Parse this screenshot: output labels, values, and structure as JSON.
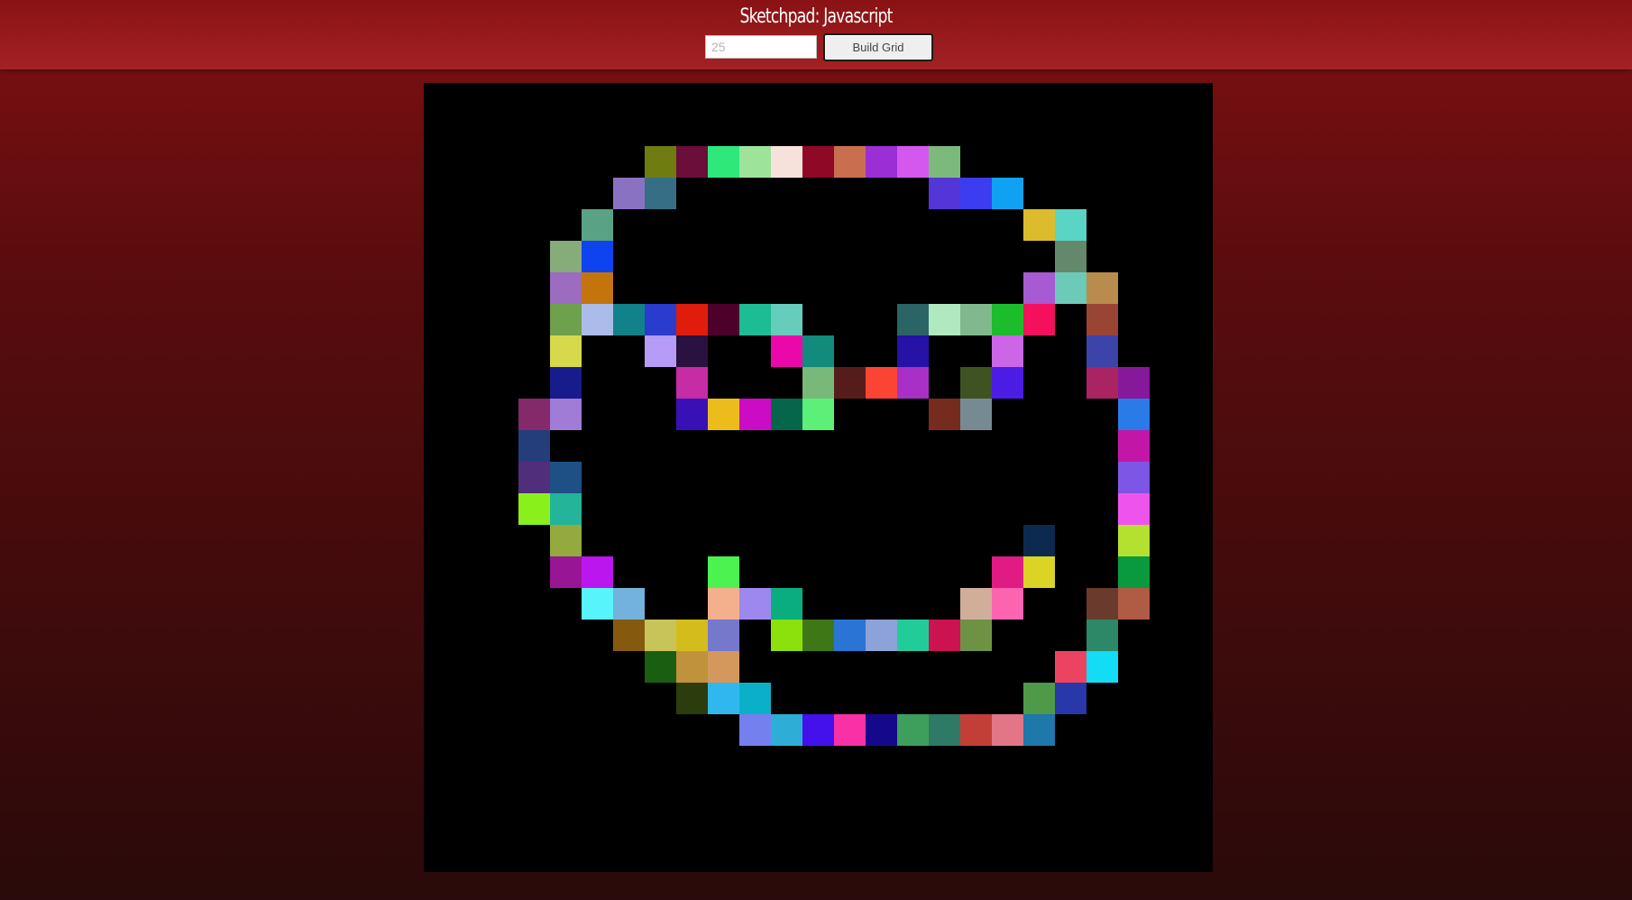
{
  "header": {
    "title": "Sketchpad: Javascript",
    "size_input": {
      "value": "",
      "placeholder": "25"
    },
    "build_button_label": "Build Grid"
  },
  "grid": {
    "size": 25,
    "background": "#000000",
    "painted_cells": [
      {
        "row": 2,
        "col": 7,
        "color": "#6f7c12"
      },
      {
        "row": 2,
        "col": 8,
        "color": "#6b0e3a"
      },
      {
        "row": 2,
        "col": 9,
        "color": "#2ee87c"
      },
      {
        "row": 2,
        "col": 10,
        "color": "#9de49a"
      },
      {
        "row": 2,
        "col": 11,
        "color": "#f6e2db"
      },
      {
        "row": 2,
        "col": 12,
        "color": "#8f0826"
      },
      {
        "row": 2,
        "col": 13,
        "color": "#c96f50"
      },
      {
        "row": 2,
        "col": 14,
        "color": "#9b2fd6"
      },
      {
        "row": 2,
        "col": 15,
        "color": "#d458ee"
      },
      {
        "row": 2,
        "col": 16,
        "color": "#7cba7c"
      },
      {
        "row": 3,
        "col": 6,
        "color": "#8a72c2"
      },
      {
        "row": 3,
        "col": 7,
        "color": "#366e86"
      },
      {
        "row": 3,
        "col": 16,
        "color": "#5436d8"
      },
      {
        "row": 3,
        "col": 17,
        "color": "#3c3cf0"
      },
      {
        "row": 3,
        "col": 18,
        "color": "#10a2f2"
      },
      {
        "row": 4,
        "col": 5,
        "color": "#5aa286"
      },
      {
        "row": 4,
        "col": 19,
        "color": "#dcbc2c"
      },
      {
        "row": 4,
        "col": 20,
        "color": "#5ad4c4"
      },
      {
        "row": 5,
        "col": 4,
        "color": "#86ac7a"
      },
      {
        "row": 5,
        "col": 5,
        "color": "#0e44f0"
      },
      {
        "row": 5,
        "col": 20,
        "color": "#64886c"
      },
      {
        "row": 6,
        "col": 4,
        "color": "#9c6cc0"
      },
      {
        "row": 6,
        "col": 5,
        "color": "#c4740c"
      },
      {
        "row": 6,
        "col": 19,
        "color": "#a85ad2"
      },
      {
        "row": 6,
        "col": 20,
        "color": "#6ccab8"
      },
      {
        "row": 6,
        "col": 21,
        "color": "#b88c4c"
      },
      {
        "row": 7,
        "col": 4,
        "color": "#6ea04e"
      },
      {
        "row": 7,
        "col": 5,
        "color": "#acbcea"
      },
      {
        "row": 7,
        "col": 6,
        "color": "#12828a"
      },
      {
        "row": 7,
        "col": 7,
        "color": "#2a3cce"
      },
      {
        "row": 7,
        "col": 8,
        "color": "#e01c0c"
      },
      {
        "row": 7,
        "col": 9,
        "color": "#4c002a"
      },
      {
        "row": 7,
        "col": 10,
        "color": "#1cbc94"
      },
      {
        "row": 7,
        "col": 11,
        "color": "#66ccbc"
      },
      {
        "row": 7,
        "col": 15,
        "color": "#2a6464"
      },
      {
        "row": 7,
        "col": 16,
        "color": "#b2e8c0"
      },
      {
        "row": 7,
        "col": 17,
        "color": "#82b88e"
      },
      {
        "row": 7,
        "col": 18,
        "color": "#1cbc2c"
      },
      {
        "row": 7,
        "col": 19,
        "color": "#f4105c"
      },
      {
        "row": 7,
        "col": 21,
        "color": "#9a4434"
      },
      {
        "row": 8,
        "col": 4,
        "color": "#d8d84c"
      },
      {
        "row": 8,
        "col": 7,
        "color": "#b69cf6"
      },
      {
        "row": 8,
        "col": 8,
        "color": "#2a1240"
      },
      {
        "row": 8,
        "col": 11,
        "color": "#ea08aa"
      },
      {
        "row": 8,
        "col": 12,
        "color": "#128a7c"
      },
      {
        "row": 8,
        "col": 15,
        "color": "#2612a6"
      },
      {
        "row": 8,
        "col": 18,
        "color": "#cc66e6"
      },
      {
        "row": 8,
        "col": 21,
        "color": "#3c44aa"
      },
      {
        "row": 9,
        "col": 4,
        "color": "#161c8c"
      },
      {
        "row": 9,
        "col": 8,
        "color": "#c62ca4"
      },
      {
        "row": 9,
        "col": 12,
        "color": "#78b878"
      },
      {
        "row": 9,
        "col": 13,
        "color": "#561c1c"
      },
      {
        "row": 9,
        "col": 14,
        "color": "#fa4434"
      },
      {
        "row": 9,
        "col": 15,
        "color": "#a830c6"
      },
      {
        "row": 9,
        "col": 17,
        "color": "#3e5222"
      },
      {
        "row": 9,
        "col": 18,
        "color": "#4c1ce4"
      },
      {
        "row": 9,
        "col": 21,
        "color": "#aa2464"
      },
      {
        "row": 9,
        "col": 22,
        "color": "#86189a"
      },
      {
        "row": 10,
        "col": 3,
        "color": "#842a6a"
      },
      {
        "row": 10,
        "col": 4,
        "color": "#a07cd6"
      },
      {
        "row": 10,
        "col": 8,
        "color": "#3810b6"
      },
      {
        "row": 10,
        "col": 9,
        "color": "#ecbc1c"
      },
      {
        "row": 10,
        "col": 10,
        "color": "#cc0cc4"
      },
      {
        "row": 10,
        "col": 11,
        "color": "#06664c"
      },
      {
        "row": 10,
        "col": 12,
        "color": "#5cf078"
      },
      {
        "row": 10,
        "col": 16,
        "color": "#762c1c"
      },
      {
        "row": 10,
        "col": 17,
        "color": "#768a94"
      },
      {
        "row": 10,
        "col": 22,
        "color": "#2a7ae8"
      },
      {
        "row": 11,
        "col": 3,
        "color": "#243e7c"
      },
      {
        "row": 11,
        "col": 22,
        "color": "#c416a6"
      },
      {
        "row": 12,
        "col": 3,
        "color": "#502e7c"
      },
      {
        "row": 12,
        "col": 4,
        "color": "#1e5086"
      },
      {
        "row": 12,
        "col": 22,
        "color": "#7e56e6"
      },
      {
        "row": 13,
        "col": 3,
        "color": "#8af01c"
      },
      {
        "row": 13,
        "col": 4,
        "color": "#24b49a"
      },
      {
        "row": 13,
        "col": 22,
        "color": "#ee54ec"
      },
      {
        "row": 14,
        "col": 4,
        "color": "#94aa3e"
      },
      {
        "row": 14,
        "col": 19,
        "color": "#0c2a50"
      },
      {
        "row": 14,
        "col": 22,
        "color": "#b4e030"
      },
      {
        "row": 15,
        "col": 4,
        "color": "#981694"
      },
      {
        "row": 15,
        "col": 5,
        "color": "#bc16ee"
      },
      {
        "row": 15,
        "col": 9,
        "color": "#4cf250"
      },
      {
        "row": 15,
        "col": 18,
        "color": "#e01c84"
      },
      {
        "row": 15,
        "col": 19,
        "color": "#dcd424"
      },
      {
        "row": 15,
        "col": 22,
        "color": "#089a3c"
      },
      {
        "row": 16,
        "col": 5,
        "color": "#58f4fc"
      },
      {
        "row": 16,
        "col": 6,
        "color": "#72b2dc"
      },
      {
        "row": 16,
        "col": 9,
        "color": "#f4b08c"
      },
      {
        "row": 16,
        "col": 10,
        "color": "#9c88ee"
      },
      {
        "row": 16,
        "col": 11,
        "color": "#0aae7e"
      },
      {
        "row": 16,
        "col": 17,
        "color": "#d0ae9a"
      },
      {
        "row": 16,
        "col": 18,
        "color": "#fc64b0"
      },
      {
        "row": 16,
        "col": 21,
        "color": "#6a3a2c"
      },
      {
        "row": 16,
        "col": 22,
        "color": "#b05c44"
      },
      {
        "row": 17,
        "col": 6,
        "color": "#865a0e"
      },
      {
        "row": 17,
        "col": 7,
        "color": "#c8c45a"
      },
      {
        "row": 17,
        "col": 8,
        "color": "#d4bc1c"
      },
      {
        "row": 17,
        "col": 9,
        "color": "#7678cc"
      },
      {
        "row": 17,
        "col": 11,
        "color": "#8ce00c"
      },
      {
        "row": 17,
        "col": 12,
        "color": "#3e7816"
      },
      {
        "row": 17,
        "col": 13,
        "color": "#2a74d6"
      },
      {
        "row": 17,
        "col": 14,
        "color": "#8ca2d8"
      },
      {
        "row": 17,
        "col": 15,
        "color": "#22cc9a"
      },
      {
        "row": 17,
        "col": 16,
        "color": "#cc1250"
      },
      {
        "row": 17,
        "col": 17,
        "color": "#6e9244"
      },
      {
        "row": 17,
        "col": 21,
        "color": "#2c8866"
      },
      {
        "row": 18,
        "col": 7,
        "color": "#1a5e12"
      },
      {
        "row": 18,
        "col": 8,
        "color": "#c0923c"
      },
      {
        "row": 18,
        "col": 9,
        "color": "#d4985c"
      },
      {
        "row": 18,
        "col": 20,
        "color": "#ec4460"
      },
      {
        "row": 18,
        "col": 21,
        "color": "#12dcf6"
      },
      {
        "row": 19,
        "col": 8,
        "color": "#2c3c0c"
      },
      {
        "row": 19,
        "col": 9,
        "color": "#30b8ee"
      },
      {
        "row": 19,
        "col": 10,
        "color": "#0ab0c8"
      },
      {
        "row": 19,
        "col": 19,
        "color": "#4e9a48"
      },
      {
        "row": 19,
        "col": 20,
        "color": "#2838aa"
      },
      {
        "row": 20,
        "col": 10,
        "color": "#7480ee"
      },
      {
        "row": 20,
        "col": 11,
        "color": "#2eaed6"
      },
      {
        "row": 20,
        "col": 12,
        "color": "#4410ec"
      },
      {
        "row": 20,
        "col": 13,
        "color": "#fa30a6"
      },
      {
        "row": 20,
        "col": 14,
        "color": "#16088a"
      },
      {
        "row": 20,
        "col": 15,
        "color": "#3e9e5c"
      },
      {
        "row": 20,
        "col": 16,
        "color": "#2e7a66"
      },
      {
        "row": 20,
        "col": 17,
        "color": "#c43e38"
      },
      {
        "row": 20,
        "col": 18,
        "color": "#e27686"
      },
      {
        "row": 20,
        "col": 19,
        "color": "#1e78aa"
      }
    ]
  }
}
